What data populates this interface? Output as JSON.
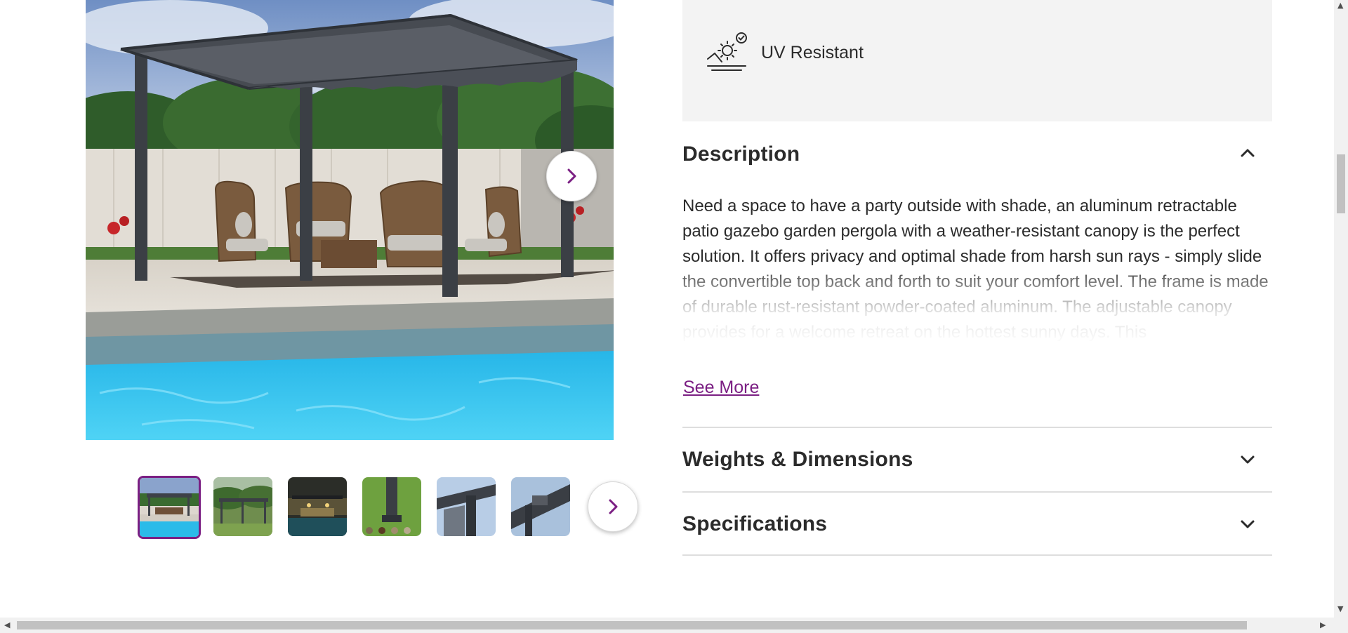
{
  "gallery": {
    "main_image_alt": "",
    "thumbnail_count_visible": 6,
    "active_thumbnail_index": 0
  },
  "features": {
    "items": [
      {
        "icon": "uv-resistant-icon",
        "label": "UV Resistant"
      }
    ]
  },
  "description": {
    "title": "Description",
    "expanded": true,
    "text": "Need a space to have a party outside with shade, an aluminum retractable patio gazebo garden pergola with a weather-resistant canopy is the perfect solution. It offers privacy and optimal shade from harsh sun rays - simply slide the convertible top back and forth to suit your comfort level. The frame is made of durable rust-resistant powder-coated aluminum. The adjustable canopy provides for a welcome retreat on the hottest sunny days. This",
    "see_more_label": "See More"
  },
  "sections": [
    {
      "title": "Weights & Dimensions",
      "expanded": false
    },
    {
      "title": "Specifications",
      "expanded": false
    }
  ],
  "colors": {
    "accent": "#7b1f83",
    "feature_panel_bg": "#f3f3f3",
    "text": "#2b2b2b",
    "divider": "#dedede"
  }
}
